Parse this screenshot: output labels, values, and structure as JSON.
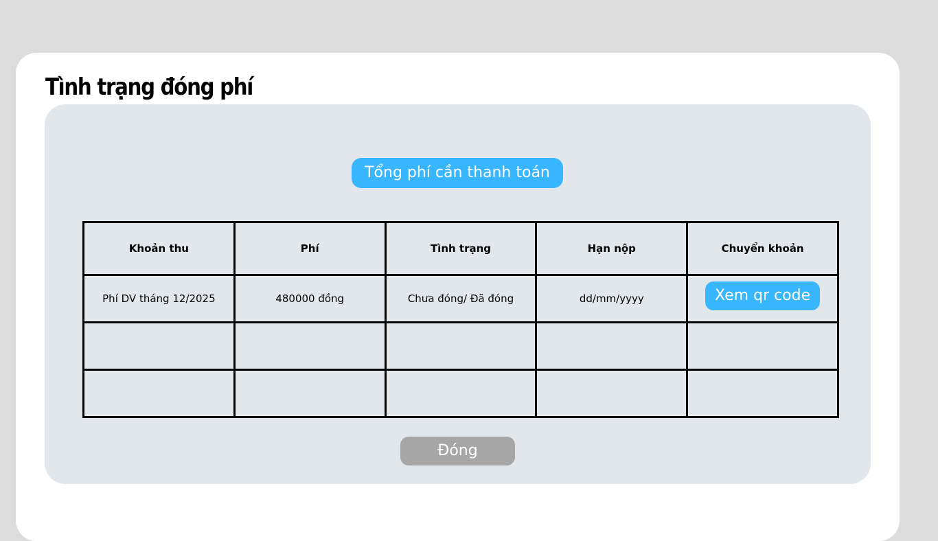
{
  "title": "Tình trạng đóng phí",
  "total_button_label": "Tổng phí cần thanh toán",
  "table": {
    "headers": [
      "Khoản thu",
      "Phí",
      "Tình trạng",
      "Hạn nộp",
      "Chuyển khoản"
    ],
    "rows": [
      {
        "item": "Phí DV tháng 12/2025",
        "fee": "480000 đồng",
        "status": "Chưa đóng/ Đã đóng",
        "deadline": "dd/mm/yyyy",
        "transfer_label": "Xem qr code"
      },
      {
        "item": "",
        "fee": "",
        "status": "",
        "deadline": "",
        "transfer_label": ""
      },
      {
        "item": "",
        "fee": "",
        "status": "",
        "deadline": "",
        "transfer_label": ""
      }
    ]
  },
  "close_button_label": "Đóng",
  "colors": {
    "background": "#dcdcdc",
    "modal": "#ffffff",
    "panel": "#e2e7ec",
    "accent": "#38b6ff",
    "close_button": "#a6a6a6"
  }
}
